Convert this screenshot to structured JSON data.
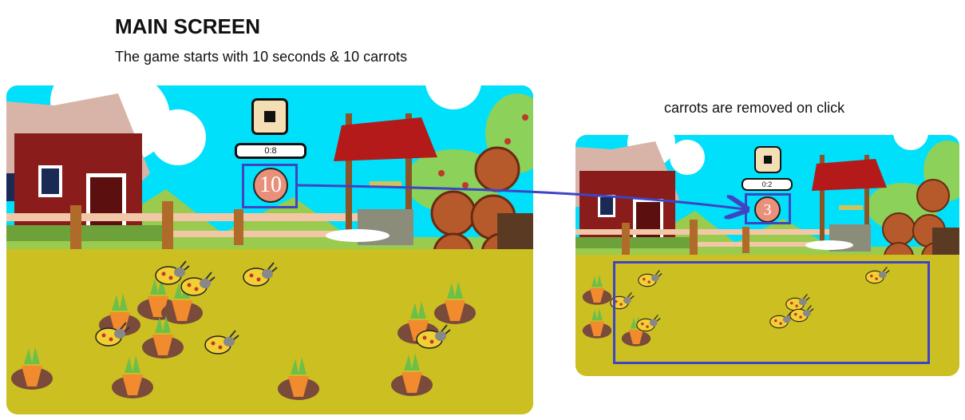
{
  "header": {
    "title": "MAIN SCREEN",
    "subtitle": "The game starts with 10 seconds & 10 carrots"
  },
  "annotation": {
    "text": "carrots are removed on click"
  },
  "main_screen": {
    "timer_text": "0:8",
    "carrot_count": "10",
    "pause_icon": "stop-square-icon"
  },
  "second_screen": {
    "timer_text": "0:2",
    "carrot_count": "3",
    "pause_icon": "stop-square-icon"
  },
  "colors": {
    "sky": "#00e0fb",
    "ground": "#ccbf22",
    "highlight": "#3f45c2",
    "counter_fill": "#e8907a",
    "barn_red": "#8a1c1c",
    "carrot": "#f28a2e",
    "bug": "#f2d033"
  }
}
